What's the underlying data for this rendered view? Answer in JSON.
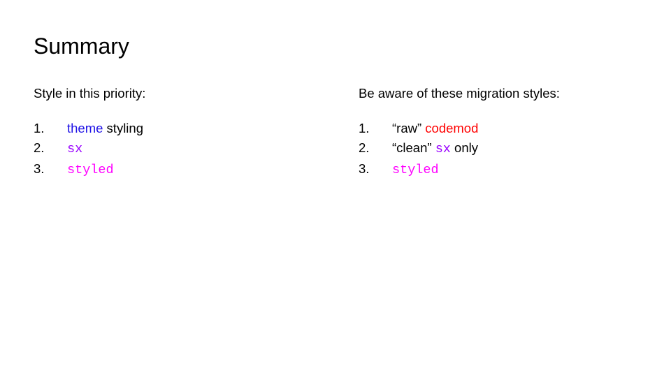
{
  "title": "Summary",
  "colors": {
    "blue": "#1f12e6",
    "purple": "#9900ff",
    "magenta": "#ff00ff",
    "red": "#ff0000",
    "black": "#000000"
  },
  "left": {
    "lead": "Style in this priority:",
    "items": [
      [
        {
          "text": "theme",
          "color": "blue"
        },
        {
          "text": " styling",
          "color": "black"
        }
      ],
      [
        {
          "text": "sx",
          "color": "purple",
          "mono": true
        }
      ],
      [
        {
          "text": "styled",
          "color": "magenta",
          "mono": true
        }
      ]
    ]
  },
  "right": {
    "lead": "Be aware of these migration styles:",
    "items": [
      [
        {
          "text": "“raw” ",
          "color": "black"
        },
        {
          "text": "codemod",
          "color": "red"
        }
      ],
      [
        {
          "text": "“clean” ",
          "color": "black"
        },
        {
          "text": "sx",
          "color": "purple",
          "mono": true
        },
        {
          "text": " only",
          "color": "black"
        }
      ],
      [
        {
          "text": "styled",
          "color": "magenta",
          "mono": true
        }
      ]
    ]
  }
}
